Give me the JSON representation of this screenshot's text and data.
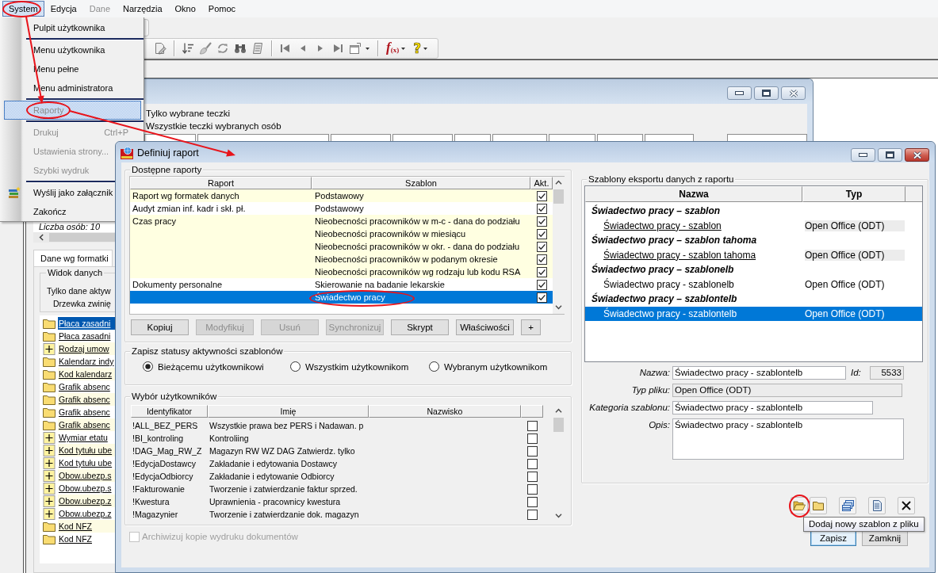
{
  "menu_bar": [
    {
      "label": "System",
      "selected": true,
      "disabled": false,
      "circled": true
    },
    {
      "label": "Edycja",
      "selected": false,
      "disabled": false,
      "circled": false
    },
    {
      "label": "Dane",
      "selected": false,
      "disabled": true,
      "circled": false
    },
    {
      "label": "Narzędzia",
      "selected": false,
      "disabled": false,
      "circled": false
    },
    {
      "label": "Okno",
      "selected": false,
      "disabled": false,
      "circled": false
    },
    {
      "label": "Pomoc",
      "selected": false,
      "disabled": false,
      "circled": false
    }
  ],
  "toolbar": {
    "formula_button": "f$_{(x)}$",
    "help_button": "?"
  },
  "system_menu": [
    {
      "kind": "item",
      "label": "Pulpit użytkownika",
      "disabled": false,
      "selected": false,
      "circled": false
    },
    {
      "kind": "separator"
    },
    {
      "kind": "item",
      "label": "Menu użytkownika",
      "disabled": false,
      "selected": false,
      "circled": false
    },
    {
      "kind": "item",
      "label": "Menu pełne",
      "disabled": false,
      "selected": false,
      "circled": false
    },
    {
      "kind": "item",
      "label": "Menu administratora",
      "disabled": false,
      "selected": false,
      "circled": false
    },
    {
      "kind": "separator"
    },
    {
      "kind": "item",
      "label": "Raporty",
      "disabled": true,
      "selected": true,
      "circled": true
    },
    {
      "kind": "separator"
    },
    {
      "kind": "item",
      "label": "Drukuj",
      "shortcut": "Ctrl+P",
      "disabled": true,
      "selected": false,
      "circled": false
    },
    {
      "kind": "item",
      "label": "Ustawienia strony...",
      "disabled": true,
      "selected": false,
      "circled": false
    },
    {
      "kind": "item",
      "label": "Szybki wydruk",
      "disabled": true,
      "selected": false,
      "circled": false
    },
    {
      "kind": "separator"
    },
    {
      "kind": "icon-item",
      "label": "Wyślij jako załącznik",
      "disabled": false,
      "selected": false,
      "circled": false
    },
    {
      "kind": "item",
      "label": "Zakończ",
      "disabled": false,
      "selected": false,
      "circled": false
    }
  ],
  "background_window": {
    "options": [
      "Tylko wybrane teczki",
      "Wszystkie teczki wybranych osób"
    ]
  },
  "left_panel": {
    "count": "Liczba osób: 10",
    "tabs": [
      {
        "label": "Dane wg formatki",
        "selected": true
      }
    ],
    "view_group": {
      "title": "Widok danych",
      "options": [
        "Tylko dane aktyw",
        "Drzewka zwinię"
      ]
    },
    "tree": [
      {
        "label": "Płaca zasadni",
        "kind": "folder",
        "selected": true
      },
      {
        "label": "Płaca zasadni",
        "kind": "folder",
        "selected": false
      },
      {
        "label": "Rodzaj umow",
        "kind": "plus",
        "selected": false
      },
      {
        "label": "Kalendarz indy",
        "kind": "folder",
        "selected": false
      },
      {
        "label": "Kod kalendarz",
        "kind": "folder",
        "selected": false
      },
      {
        "label": "Grafik absenc",
        "kind": "folder",
        "selected": false
      },
      {
        "label": "Grafik absenc",
        "kind": "folder",
        "selected": false
      },
      {
        "label": "Grafik absenc",
        "kind": "folder",
        "selected": false
      },
      {
        "label": "Grafik absenc",
        "kind": "folder",
        "selected": false
      },
      {
        "label": "Wymiar etatu",
        "kind": "plus",
        "selected": false
      },
      {
        "label": "Kod tytułu ube",
        "kind": "plus",
        "selected": false
      },
      {
        "label": "Kod tytułu ube",
        "kind": "plus",
        "selected": false
      },
      {
        "label": "Obow.ubezp.s",
        "kind": "plus",
        "selected": false
      },
      {
        "label": "Obow.ubezp.s",
        "kind": "plus",
        "selected": false
      },
      {
        "label": "Obow.ubezp.z",
        "kind": "plus",
        "selected": false
      },
      {
        "label": "Obow.ubezp.z",
        "kind": "plus",
        "selected": false
      },
      {
        "label": "Kod NFZ",
        "kind": "folder",
        "selected": false
      },
      {
        "label": "Kod NFZ",
        "kind": "folder",
        "selected": false
      }
    ]
  },
  "dialog": {
    "title": "Definiuj raport",
    "reports": {
      "title": "Dostępne raporty",
      "columns": [
        "Raport",
        "Szablon",
        "Akt."
      ],
      "groups": [
        {
          "report": "Raport wg formatek danych",
          "templates": [
            {
              "name": "Podstawowy",
              "active": true,
              "selected": false,
              "circled": false
            }
          ]
        },
        {
          "report": "Audyt zmian inf. kadr i skł. pł.",
          "templates": [
            {
              "name": "Podstawowy",
              "active": true,
              "selected": false,
              "circled": false
            }
          ]
        },
        {
          "report": "Czas pracy",
          "templates": [
            {
              "name": "Nieobecności pracowników w m-c - dana do podziału",
              "active": true,
              "selected": false,
              "circled": false
            },
            {
              "name": "Nieobecności pracowników w miesiącu",
              "active": true,
              "selected": false,
              "circled": false
            },
            {
              "name": "Nieobecności pracowników w okr. - dana do podziału",
              "active": true,
              "selected": false,
              "circled": false
            },
            {
              "name": "Nieobecności pracowników w podanym okresie",
              "active": true,
              "selected": false,
              "circled": false
            },
            {
              "name": "Nieobecności pracowników wg rodzaju lub kodu RSA",
              "active": true,
              "selected": false,
              "circled": false
            }
          ]
        },
        {
          "report": "Dokumenty personalne",
          "templates": [
            {
              "name": "Skierowanie na badanie lekarskie",
              "active": true,
              "selected": false,
              "circled": false
            },
            {
              "name": "Świadectwo pracy",
              "active": true,
              "selected": true,
              "circled": true
            }
          ]
        }
      ]
    },
    "report_buttons": [
      {
        "label": "Kopiuj",
        "disabled": false
      },
      {
        "label": "Modyfikuj",
        "disabled": true
      },
      {
        "label": "Usuń",
        "disabled": true
      },
      {
        "label": "Synchronizuj",
        "disabled": true
      },
      {
        "label": "Skrypt",
        "disabled": false
      },
      {
        "label": "Właściwości",
        "disabled": false
      },
      {
        "label": "+",
        "disabled": false
      }
    ],
    "status_scope": {
      "title": "Zapisz statusy aktywności szablonów",
      "options": [
        {
          "label": "Bieżącemu użytkownikowi",
          "selected": true
        },
        {
          "label": "Wszystkim użytkownikom",
          "selected": false
        },
        {
          "label": "Wybranym użytkownikom",
          "selected": false
        }
      ]
    },
    "users": {
      "title": "Wybór użytkowników",
      "columns": [
        "Identyfikator",
        "Imię",
        "Nazwisko"
      ],
      "rows": [
        {
          "id": "!ALL_BEZ_PERS",
          "first_name": "Wszystkie prawa bez PERS i Nadawan. p",
          "checked": false
        },
        {
          "id": "!BI_kontroling",
          "first_name": "Kontroliing",
          "checked": false
        },
        {
          "id": "!DAG_Mag_RW_Z",
          "first_name": "Magazyn RW WZ DAG Zatwierdz. tylko",
          "checked": false
        },
        {
          "id": "!EdycjaDostawcy",
          "first_name": "Zakładanie i edytowania Dostawcy",
          "checked": false
        },
        {
          "id": "!EdycjaOdbiorcy",
          "first_name": "Zakładanie i edytowanie Odbiorcy",
          "checked": false
        },
        {
          "id": "!Fakturowanie",
          "first_name": "Tworzenie i zatwierdzanie faktur sprzed.",
          "checked": false
        },
        {
          "id": "!Kwestura",
          "first_name": "Uprawnienia - pracownicy kwestura",
          "checked": false
        },
        {
          "id": "!Magazynier",
          "first_name": "Tworzenie i zatwierdzanie dok. magazyn",
          "checked": false
        }
      ]
    },
    "archive": {
      "label": "Archiwizuj kopie wydruku dokumentów",
      "checked": false,
      "disabled": true
    },
    "export_templates": {
      "title": "Szablony eksportu danych z raportu",
      "columns": [
        "Nazwa",
        "Typ"
      ],
      "groups": [
        {
          "title": "Świadectwo pracy – szablon",
          "items": [
            {
              "name": "Świadectwo pracy - szablon",
              "type": "Open Office (ODT)",
              "linked": true,
              "selected": false
            }
          ]
        },
        {
          "title": "Świadectwo pracy – szablon tahoma",
          "items": [
            {
              "name": "Świadectwo pracy - szablon tahoma",
              "type": "Open Office (ODT)",
              "linked": true,
              "selected": false
            }
          ]
        },
        {
          "title": "Świadectwo pracy – szablonelb",
          "items": [
            {
              "name": "Świadectwo pracy - szablonelb",
              "type": "Open Office (ODT)",
              "linked": false,
              "selected": false
            }
          ]
        },
        {
          "title": "Świadectwo pracy – szablontelb",
          "items": [
            {
              "name": "Świadectwo pracy - szablontelb",
              "type": "Open Office (ODT)",
              "linked": false,
              "selected": true
            }
          ]
        }
      ]
    },
    "details": {
      "name": {
        "label": "Nazwa:",
        "value": "Świadectwo pracy - szablontelb",
        "readonly": false
      },
      "id": {
        "label": "Id:",
        "value": "5533",
        "readonly": true
      },
      "file_type": {
        "label": "Typ pliku:",
        "value": "Open Office (ODT)",
        "readonly": true
      },
      "category": {
        "label": "Kategoria szablonu:",
        "value": "Świadectwo pracy - szablontelb",
        "readonly": false
      },
      "description": {
        "label": "Opis:",
        "value": "Świadectwo pracy - szablontelb",
        "readonly": false
      }
    },
    "tools": [
      {
        "kind": "open-folder",
        "circled": true
      },
      {
        "kind": "folder",
        "circled": false
      },
      {
        "kind": "stack",
        "circled": false
      },
      {
        "kind": "document",
        "circled": false
      },
      {
        "kind": "delete",
        "circled": false
      }
    ],
    "tooltip": "Dodaj nowy szablon z pliku",
    "actions": [
      {
        "label": "Zapisz",
        "default": true
      },
      {
        "label": "Zamknij",
        "default": false
      }
    ]
  }
}
